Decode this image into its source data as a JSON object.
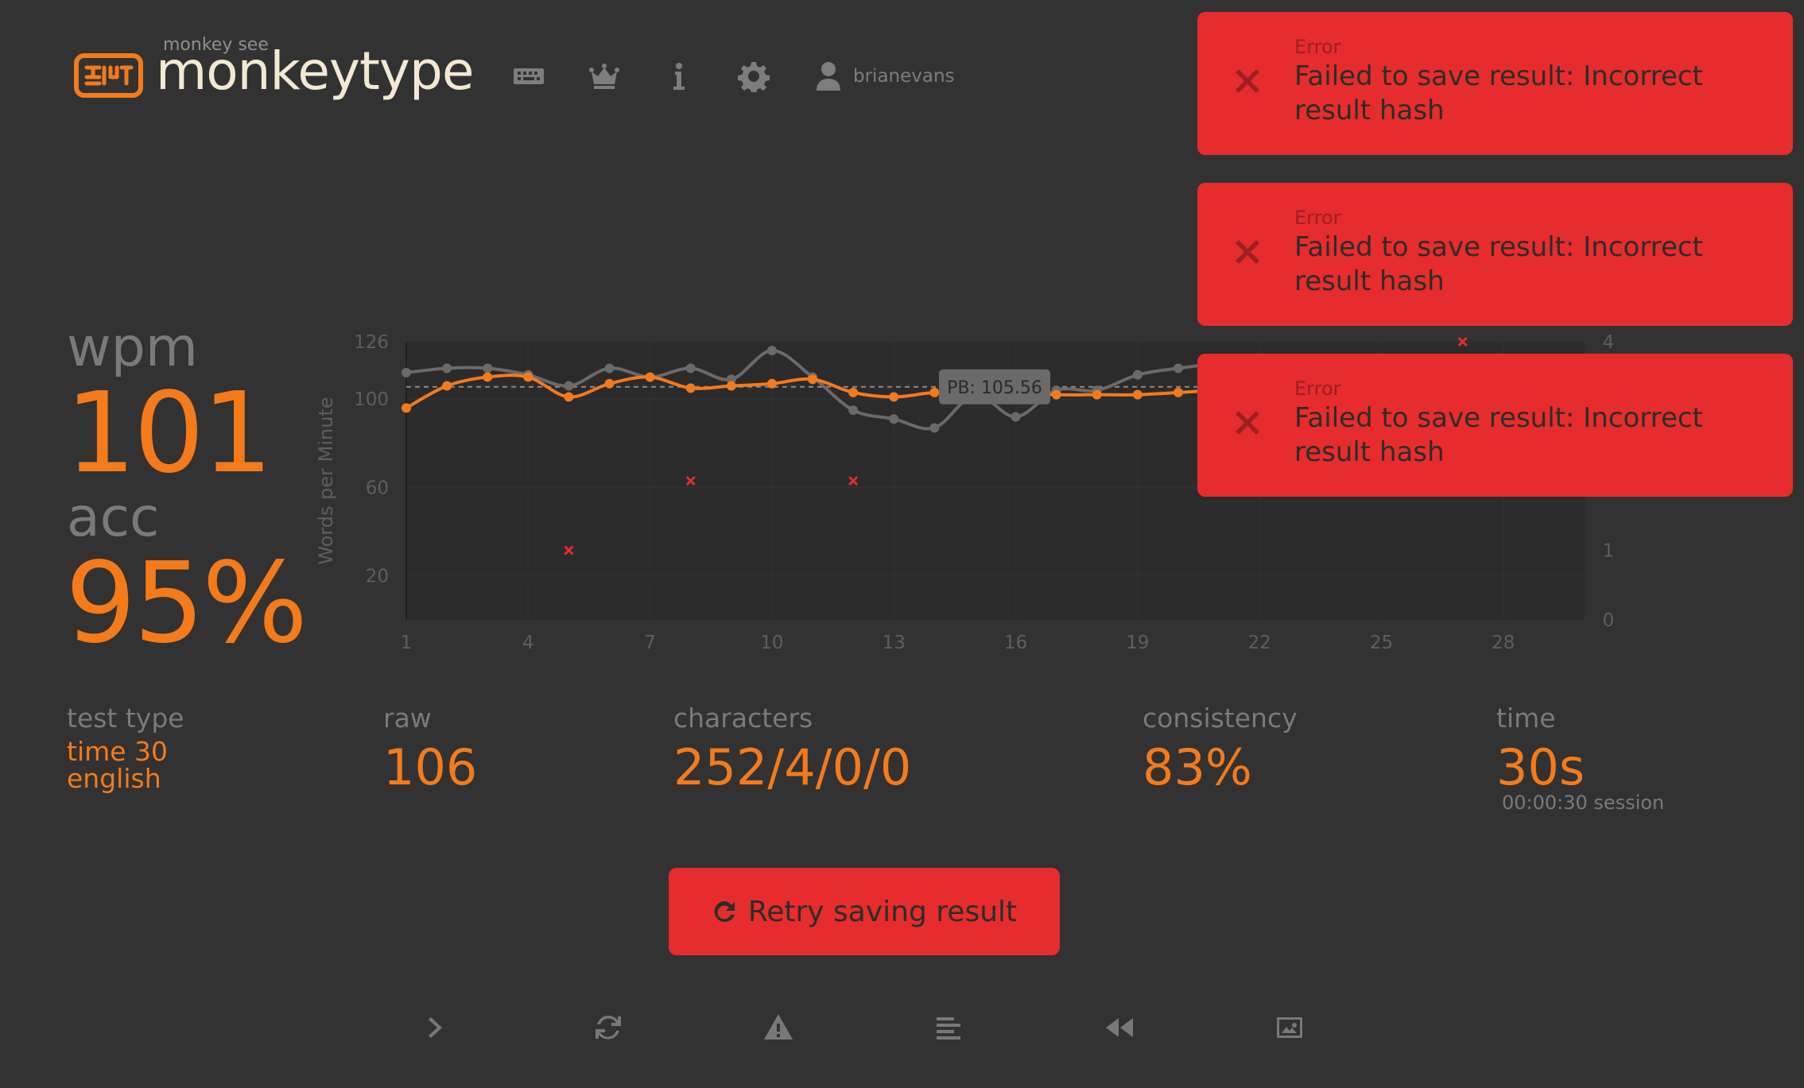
{
  "header": {
    "logo_subtitle": "monkey see",
    "logo_text": "monkeytype",
    "nav": [
      {
        "icon": "keyboard-icon"
      },
      {
        "icon": "crown-icon"
      },
      {
        "icon": "info-icon"
      },
      {
        "icon": "gear-icon"
      }
    ],
    "username": "brianevans"
  },
  "result": {
    "wpm_label": "wpm",
    "wpm_value": "101",
    "acc_label": "acc",
    "acc_value": "95%",
    "test_type_label": "test type",
    "test_type_mode": "time 30",
    "test_type_language": "english",
    "raw_label": "raw",
    "raw_value": "106",
    "characters_label": "characters",
    "characters_value": "252/4/0/0",
    "consistency_label": "consistency",
    "consistency_value": "83%",
    "time_label": "time",
    "time_value": "30s",
    "session_time": "00:00:30 session"
  },
  "retry_button": {
    "label": "Retry saving result",
    "icon": "redo-icon"
  },
  "toolbar": [
    {
      "icon": "next-test-icon"
    },
    {
      "icon": "restart-icon"
    },
    {
      "icon": "warning-icon"
    },
    {
      "icon": "words-history-icon"
    },
    {
      "icon": "replay-icon"
    },
    {
      "icon": "screenshot-icon"
    }
  ],
  "notifications": [
    {
      "title": "Error",
      "message": "Failed to save result: Incorrect result hash"
    },
    {
      "title": "Error",
      "message": "Failed to save result: Incorrect result hash"
    },
    {
      "title": "Error",
      "message": "Failed to save result: Incorrect result hash"
    }
  ],
  "colors": {
    "background": "#323232",
    "accent": "#f47a1a",
    "error": "#e62c2c",
    "raw_line": "#6a6a6a",
    "text_dim": "#7a7a7a"
  },
  "chart_data": {
    "type": "line",
    "ylabel": "Words per Minute",
    "xlabel": "",
    "y2label": "",
    "xlim": [
      1,
      30
    ],
    "ylim": [
      0,
      126
    ],
    "y2lim": [
      0,
      4
    ],
    "x_ticks": [
      1,
      4,
      7,
      10,
      13,
      16,
      19,
      22,
      25,
      28
    ],
    "y_ticks": [
      20,
      60,
      100,
      126
    ],
    "y2_ticks": [
      0,
      1,
      4
    ],
    "grid": true,
    "pb_annotation": {
      "label": "PB: 105.56",
      "value": 105.56
    },
    "series": [
      {
        "role": "raw",
        "color": "#6a6a6a",
        "x": [
          1,
          2,
          3,
          4,
          5,
          6,
          7,
          8,
          9,
          10,
          11,
          12,
          13,
          14,
          15,
          16,
          17,
          18,
          19,
          20,
          21,
          22,
          23,
          24,
          25,
          26,
          27,
          28,
          29,
          30
        ],
        "values": [
          112,
          114,
          114,
          111,
          106,
          114,
          110,
          114,
          109,
          122,
          110,
          95,
          91,
          87,
          102,
          92,
          104,
          104,
          111,
          114,
          116,
          116,
          115,
          115,
          117,
          115,
          116,
          114,
          117,
          117
        ]
      },
      {
        "role": "wpm",
        "color": "#f47a1a",
        "x": [
          1,
          2,
          3,
          4,
          5,
          6,
          7,
          8,
          9,
          10,
          11,
          12,
          13,
          14,
          15,
          16,
          17,
          18,
          19,
          20,
          21,
          22,
          23,
          24,
          25,
          26,
          27,
          28,
          29,
          30
        ],
        "values": [
          96,
          106,
          110,
          110,
          101,
          107,
          110,
          105,
          106,
          107,
          109,
          103,
          101,
          103,
          103,
          103,
          102,
          102,
          102,
          103,
          104,
          104,
          104,
          104,
          104,
          104,
          104,
          104,
          104,
          104
        ]
      },
      {
        "role": "errors",
        "color": "#e62c2c",
        "axis": "y2",
        "x": [
          5,
          8,
          12,
          27
        ],
        "values": [
          1,
          2,
          2,
          4
        ]
      }
    ]
  }
}
